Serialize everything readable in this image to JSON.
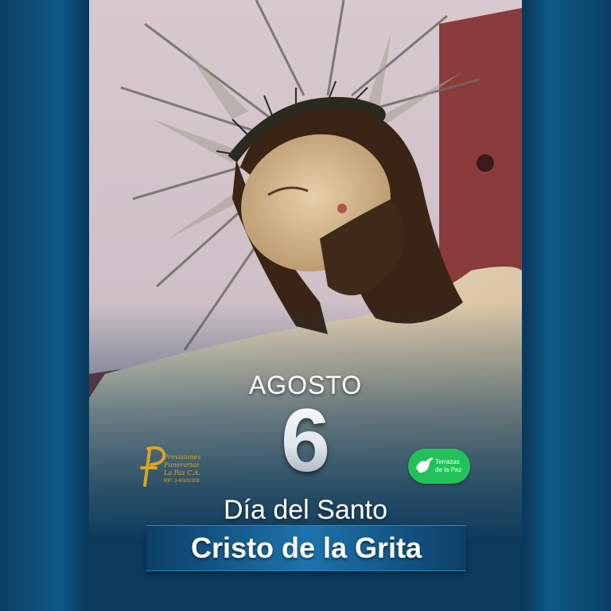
{
  "date": {
    "month": "AGOSTO",
    "day": "6"
  },
  "title": {
    "line1": "Día del Santo",
    "line2": "Cristo de la Grita"
  },
  "logos": {
    "left": {
      "name_line1": "Previsiones",
      "name_line2": "Funerarias",
      "name_line3": "La Paz C.A.",
      "rif": "RIF: J-40102308"
    },
    "right": {
      "name_line1": "Terrazas",
      "name_line2": "de la Paz"
    }
  },
  "colors": {
    "background": "#0c3a5c",
    "banner": "#1d73ad",
    "gold": "#d6a62a",
    "green": "#22c25a"
  }
}
